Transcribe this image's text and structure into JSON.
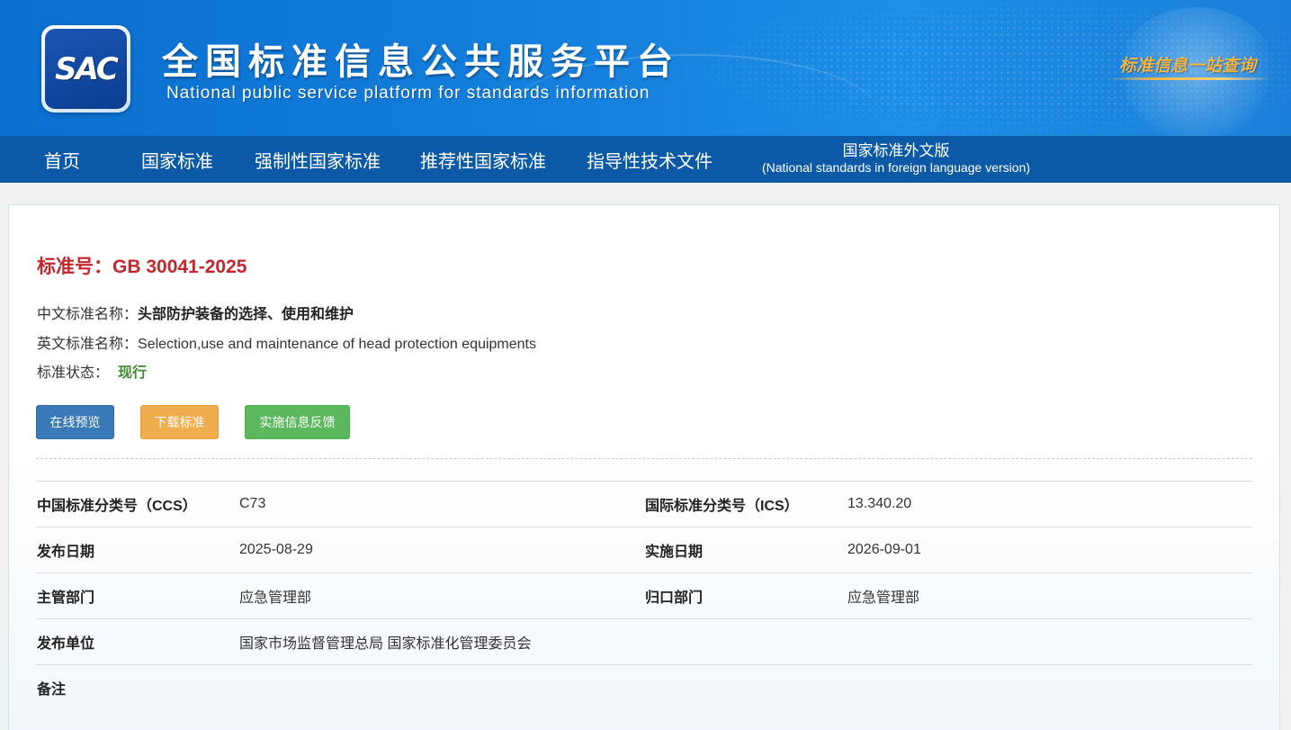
{
  "header": {
    "logo_text": "SAC",
    "site_title": "全国标准信息公共服务平台",
    "site_subtitle": "National public service platform  for standards information",
    "slogan": "标准信息一站查询"
  },
  "nav": {
    "items": [
      {
        "label": "首页"
      },
      {
        "label": "国家标准"
      },
      {
        "label": "强制性国家标准"
      },
      {
        "label": "推荐性国家标准"
      },
      {
        "label": "指导性技术文件"
      }
    ],
    "foreign": {
      "label": "国家标准外文版",
      "sublabel": "(National standards in foreign language version)"
    }
  },
  "standard": {
    "number_label": "标准号：",
    "number": "GB 30041-2025",
    "cn_name_label": "中文标准名称：",
    "cn_name": "头部防护装备的选择、使用和维护",
    "en_name_label": "英文标准名称：",
    "en_name": "Selection,use and maintenance of head protection equipments",
    "status_label": "标准状态：",
    "status": "现行",
    "status_color": "#3c8b2f",
    "number_color": "#c1272d"
  },
  "actions": {
    "preview": "在线预览",
    "download": "下载标准",
    "feedback": "实施信息反馈"
  },
  "meta": {
    "ccs_label": "中国标准分类号（CCS）",
    "ccs": "C73",
    "ics_label": "国际标准分类号（ICS）",
    "ics": "13.340.20",
    "publish_date_label": "发布日期",
    "publish_date": "2025-08-29",
    "effective_date_label": "实施日期",
    "effective_date": "2026-09-01",
    "authority_label": "主管部门",
    "authority": "应急管理部",
    "centralized_label": "归口部门",
    "centralized": "应急管理部",
    "issuer_label": "发布单位",
    "issuer": "国家市场监督管理总局 国家标准化管理委员会",
    "remark_label": "备注",
    "remark": ""
  }
}
